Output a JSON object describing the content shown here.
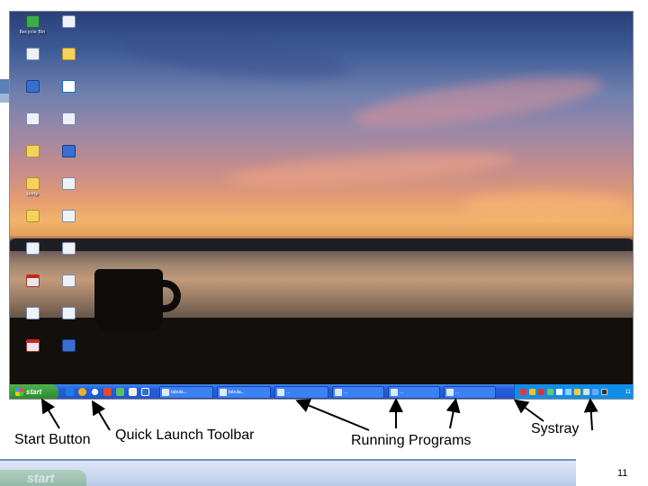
{
  "annotations": {
    "start_button": "Start Button",
    "quick_launch": "Quick Launch Toolbar",
    "running_programs": "Running Programs",
    "systray": "Systray"
  },
  "taskbar": {
    "start_label": "start",
    "tasks": [
      "tabula...",
      "tabula...",
      "...",
      "...",
      "...",
      "..."
    ],
    "clock": "11"
  },
  "desktop_icons": [
    {
      "label": "Recycle Bin",
      "glyph": "recycle-bin-icon"
    },
    {
      "label": "",
      "glyph": "document-icon"
    },
    {
      "label": "",
      "glyph": "document-icon"
    },
    {
      "label": "",
      "glyph": "folder-icon"
    },
    {
      "label": "",
      "glyph": "application-icon"
    },
    {
      "label": "",
      "glyph": "internet-explorer-icon"
    },
    {
      "label": "",
      "glyph": "document-icon"
    },
    {
      "label": "",
      "glyph": "document-icon"
    },
    {
      "label": "",
      "glyph": "folder-icon"
    },
    {
      "label": "",
      "glyph": "application-icon"
    },
    {
      "label": "temp",
      "glyph": "folder-icon"
    },
    {
      "label": "",
      "glyph": "document-icon"
    },
    {
      "label": "",
      "glyph": "folder-icon"
    },
    {
      "label": "",
      "glyph": "document-icon"
    },
    {
      "label": "",
      "glyph": "document-icon"
    },
    {
      "label": "",
      "glyph": "document-icon"
    },
    {
      "label": "",
      "glyph": "pdf-icon"
    },
    {
      "label": "",
      "glyph": "document-icon"
    },
    {
      "label": "",
      "glyph": "document-icon"
    },
    {
      "label": "",
      "glyph": "document-icon"
    },
    {
      "label": "",
      "glyph": "pdf-icon"
    },
    {
      "label": "",
      "glyph": "application-icon"
    }
  ],
  "footer": {
    "start_text": "start",
    "page_number": "11"
  },
  "colors": {
    "taskbar_blue": "#245edc",
    "start_green": "#3a9a3a",
    "systray_blue": "#0f8ee8"
  }
}
